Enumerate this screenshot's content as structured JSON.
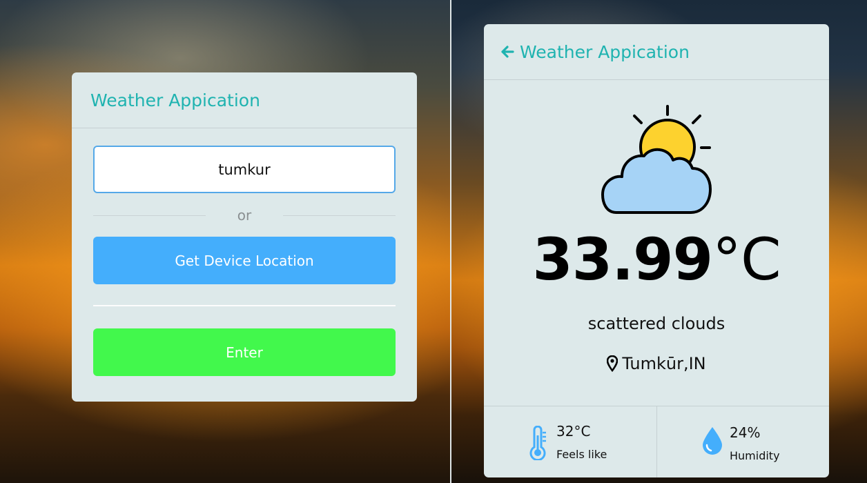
{
  "app_title": "Weather Appication",
  "search": {
    "value": "tumkur",
    "divider_text": "or",
    "location_button": "Get Device Location",
    "enter_button": "Enter"
  },
  "weather": {
    "temperature": "33.99",
    "unit": "°C",
    "description": "scattered clouds",
    "location": "Tumkūr,IN",
    "icon": "partly-cloudy-icon",
    "feels_like_value": "32°C",
    "feels_like_label": "Feels like",
    "humidity_value": "24%",
    "humidity_label": "Humidity"
  },
  "colors": {
    "accent": "#1fb3b0",
    "location_button": "#44aefc",
    "enter_button": "#42f84c",
    "card_bg": "#dde9ea"
  }
}
